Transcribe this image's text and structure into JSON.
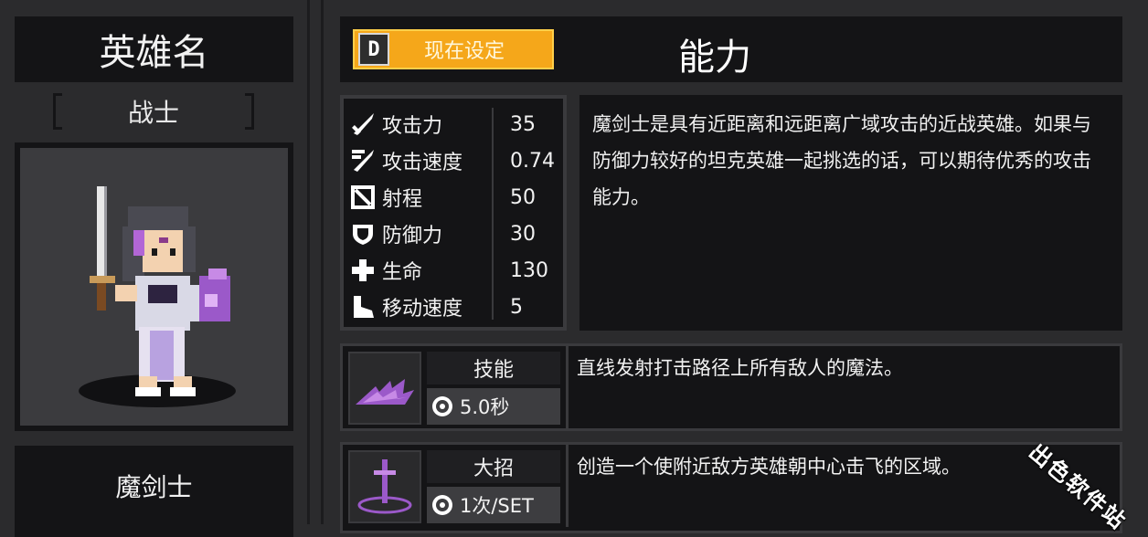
{
  "hero_panel": {
    "title": "英雄名",
    "class_name": "战士",
    "hero_name": "魔剑士"
  },
  "header": {
    "preset_key": "D",
    "preset_label": "现在设定",
    "section_title": "能力"
  },
  "stats": [
    {
      "icon": "sword-attack-icon",
      "label": "攻击力",
      "value": "35"
    },
    {
      "icon": "attack-speed-icon",
      "label": "攻击速度",
      "value": "0.74"
    },
    {
      "icon": "bow-range-icon",
      "label": "射程",
      "value": "50"
    },
    {
      "icon": "shield-defense-icon",
      "label": "防御力",
      "value": "30"
    },
    {
      "icon": "health-cross-icon",
      "label": "生命",
      "value": "130"
    },
    {
      "icon": "boot-speed-icon",
      "label": "移动速度",
      "value": "5"
    }
  ],
  "description": "魔剑士是具有近距离和远距离广域攻击的近战英雄。如果与防御力较好的坦克英雄一起挑选的话，可以期待优秀的攻击能力。",
  "skills": [
    {
      "name": "技能",
      "meta": "5.0秒",
      "desc": "直线发射打击路径上所有敌人的魔法。"
    },
    {
      "name": "大招",
      "meta": "1次/SET",
      "desc": "创造一个使附近敌方英雄朝中心击飞的区域。"
    }
  ],
  "watermark": "出色软件站",
  "colors": {
    "preset_button": "#f5a71a",
    "panel_dark": "#141416",
    "background": "#2b2b2d",
    "skill_purple": "#9b59c9"
  }
}
